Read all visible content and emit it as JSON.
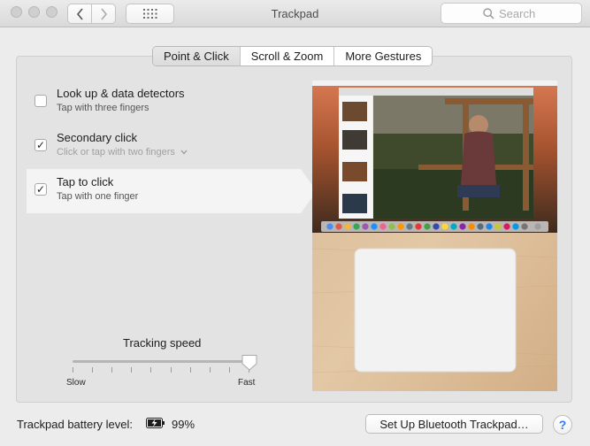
{
  "window": {
    "title": "Trackpad"
  },
  "toolbar": {
    "search_placeholder": "Search"
  },
  "tabs": [
    {
      "label": "Point & Click",
      "active": true
    },
    {
      "label": "Scroll & Zoom",
      "active": false
    },
    {
      "label": "More Gestures",
      "active": false
    }
  ],
  "options": [
    {
      "title": "Look up & data detectors",
      "subtitle": "Tap with three fingers",
      "checked": false
    },
    {
      "title": "Secondary click",
      "subtitle": "Click or tap with two fingers",
      "checked": true
    },
    {
      "title": "Tap to click",
      "subtitle": "Tap with one finger",
      "checked": true
    }
  ],
  "tracking": {
    "title": "Tracking speed",
    "min_label": "Slow",
    "max_label": "Fast",
    "value": 1.0
  },
  "footer": {
    "battery_label": "Trackpad battery level:",
    "battery_percent": "99%",
    "setup_button": "Set Up Bluetooth Trackpad…",
    "help_button": "?"
  },
  "colors": {
    "accent": "#3478f6",
    "panel": "#e3e3e3",
    "selected_row": "#f4f4f4"
  }
}
